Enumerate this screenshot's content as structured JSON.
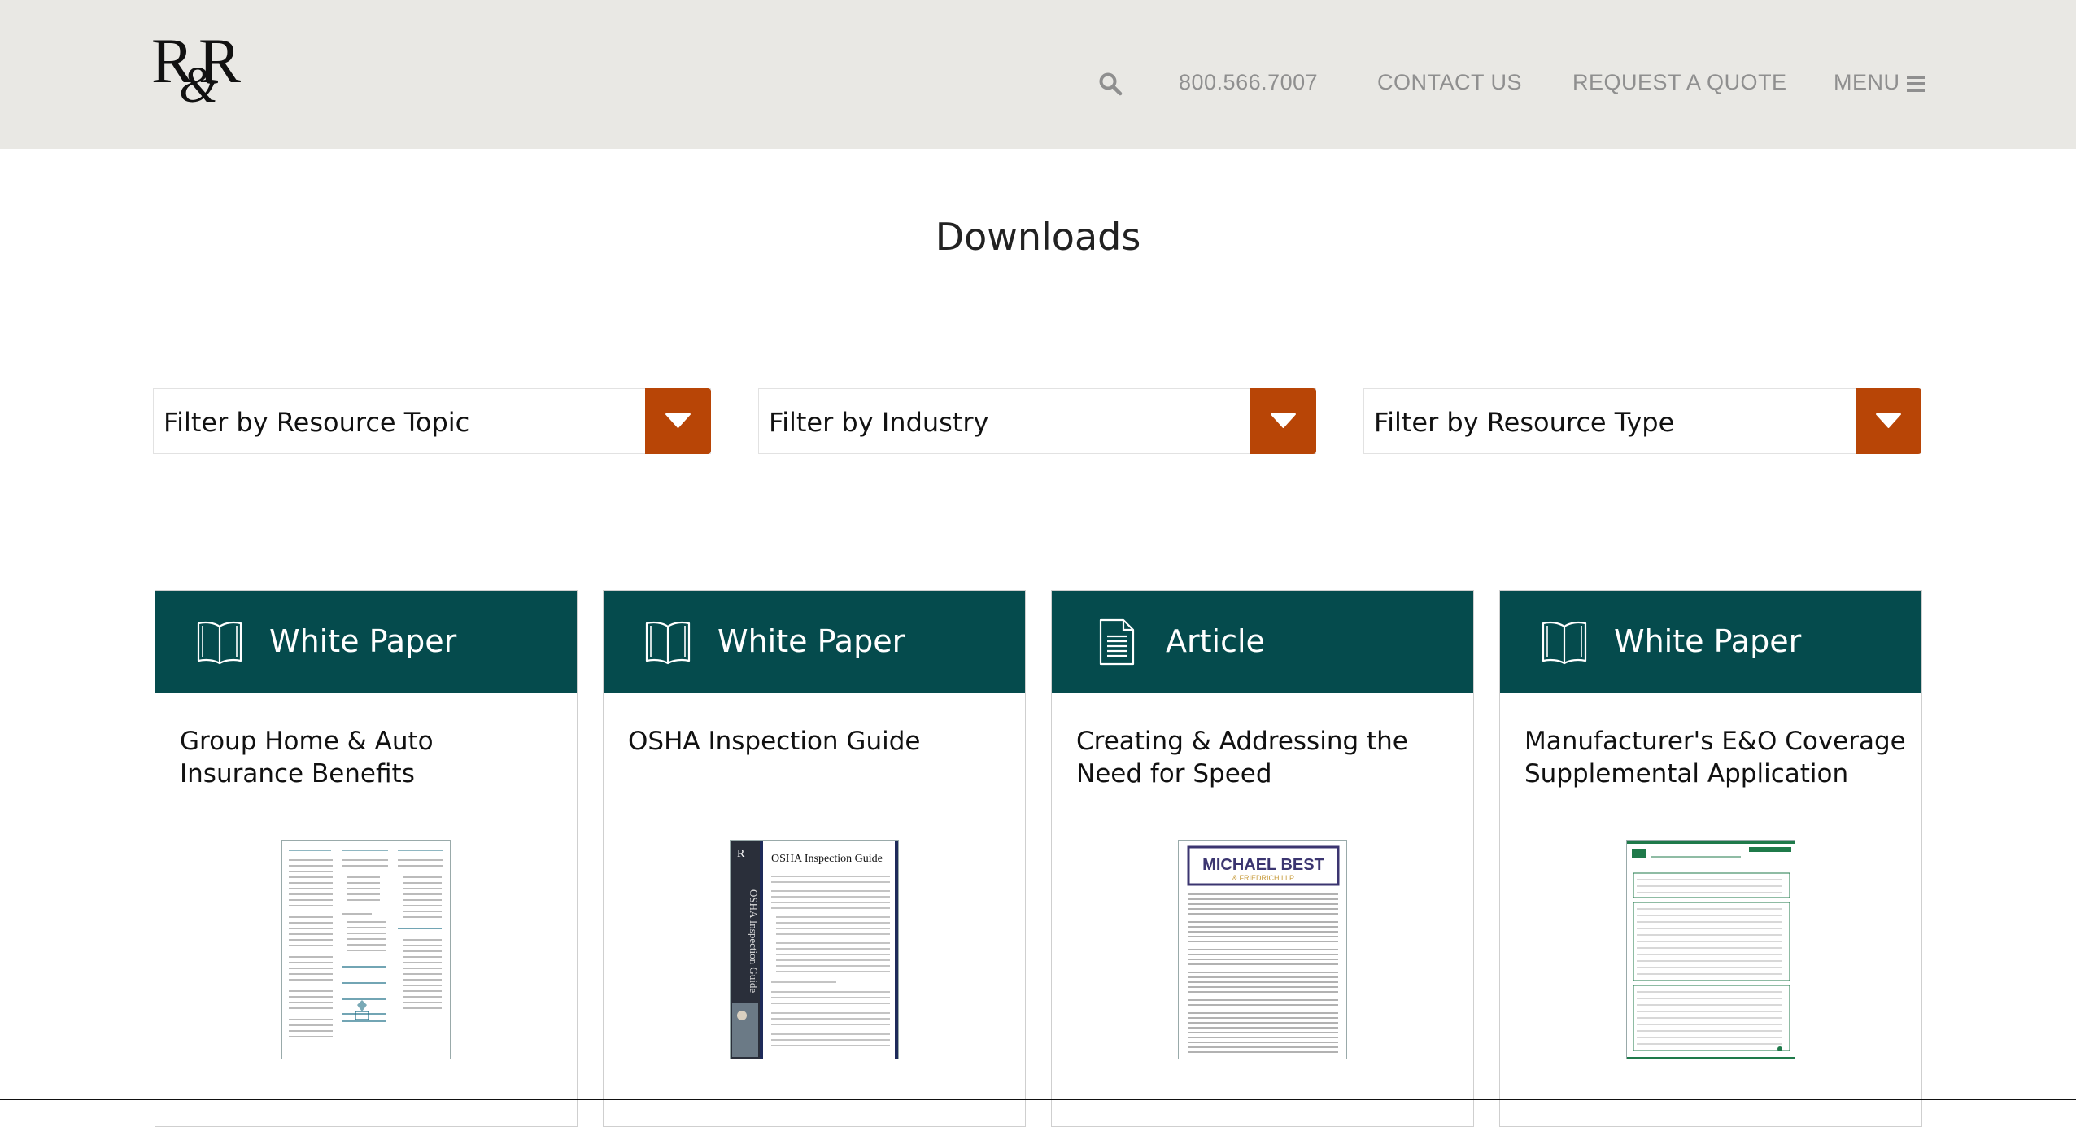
{
  "header": {
    "logo_text": "R&R",
    "phone": "800.566.7007",
    "contact": "CONTACT US",
    "quote": "REQUEST A QUOTE",
    "menu": "MENU"
  },
  "page": {
    "title": "Downloads"
  },
  "filters": [
    {
      "label": "Filter by Resource Topic"
    },
    {
      "label": "Filter by Industry"
    },
    {
      "label": "Filter by Resource Type"
    }
  ],
  "cards": [
    {
      "type": "White Paper",
      "icon": "book-icon",
      "title": "Group Home & Auto Insurance Benefits"
    },
    {
      "type": "White Paper",
      "icon": "book-icon",
      "title": "OSHA Inspection Guide"
    },
    {
      "type": "Article",
      "icon": "document-icon",
      "title": "Creating & Addressing the Need for Speed"
    },
    {
      "type": "White Paper",
      "icon": "book-icon",
      "title": "Manufacturer's E&O Coverage Supplemental Application"
    }
  ],
  "thumbnails": {
    "osha_title": "OSHA Inspection Guide",
    "osha_spine": "OSHA Inspection Guide",
    "mb_name": "MICHAEL BEST",
    "mb_sub": "& FRIEDRICH LLP"
  },
  "colors": {
    "header_bg": "#e9e8e4",
    "accent_orange": "#b84506",
    "card_teal": "#054b4d"
  }
}
